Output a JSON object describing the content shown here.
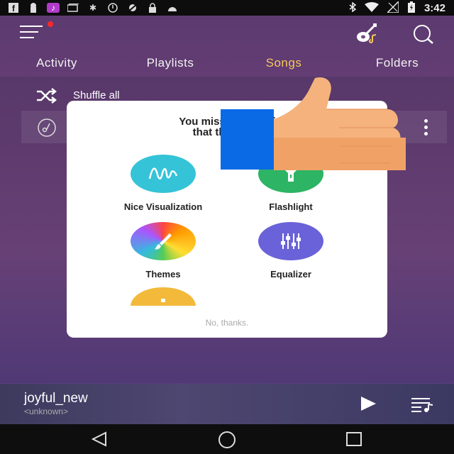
{
  "status_bar": {
    "time": "3:42",
    "icons": [
      "facebook-icon",
      "keyhole-icon",
      "music-note-icon",
      "cards-icon",
      "tree-icon",
      "alert-icon",
      "no-gps-icon",
      "lock-icon",
      "android-icon",
      "bluetooth-icon",
      "wifi-icon",
      "no-sim-icon",
      "battery-charging-icon"
    ]
  },
  "header": {
    "menu_icon": "menu-icon",
    "has_notification_dot": true,
    "guitar_icon": "guitar-icon",
    "search_icon": "search-icon"
  },
  "tabs": [
    {
      "label": "Activity",
      "active": false
    },
    {
      "label": "Playlists",
      "active": false
    },
    {
      "label": "Songs",
      "active": true
    },
    {
      "label": "Folders",
      "active": false
    }
  ],
  "list": {
    "shuffle_label": "Shuffle all"
  },
  "dialog": {
    "title_line1": "You missed these f",
    "title_line2": "that they wou",
    "features": [
      {
        "label": "Nice Visualization",
        "color": "#35c3d7"
      },
      {
        "label": "Flashlight",
        "color": "#2db464"
      },
      {
        "label": "Themes",
        "color": "#f0a040"
      },
      {
        "label": "Equalizer",
        "color": "#6a62d8"
      },
      {
        "label": "",
        "color": "#f2b93a"
      }
    ],
    "dismiss": "No, thanks."
  },
  "player": {
    "title": "joyful_new",
    "artist": "<unknown>"
  },
  "colors": {
    "accent": "#f4c85a",
    "overlay_blue": "#0a6ae6",
    "thumb_skin": "#f5b27c"
  }
}
